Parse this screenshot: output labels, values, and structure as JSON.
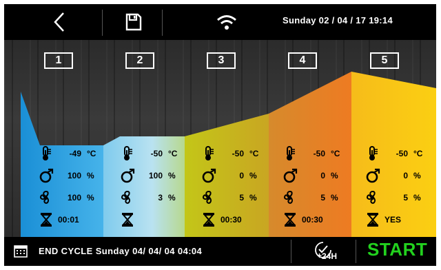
{
  "header": {
    "back_icon": "back-arrow-icon",
    "save_icon": "floppy-disk-icon",
    "wifi_icon": "wifi-icon",
    "datetime": "Sunday 02 / 04 / 17  19:14"
  },
  "phases": [
    {
      "number": "1",
      "temperature": "-49",
      "temp_unit": "°C",
      "vacuum": "100",
      "vacuum_unit": "%",
      "fan": "100",
      "fan_unit": "%",
      "time": "00:01"
    },
    {
      "number": "2",
      "temperature": "-50",
      "temp_unit": "°C",
      "vacuum": "100",
      "vacuum_unit": "%",
      "fan": "3",
      "fan_unit": "%",
      "time": ""
    },
    {
      "number": "3",
      "temperature": "-50",
      "temp_unit": "°C",
      "vacuum": "0",
      "vacuum_unit": "%",
      "fan": "5",
      "fan_unit": "%",
      "time": "00:30"
    },
    {
      "number": "4",
      "temperature": "-50",
      "temp_unit": "°C",
      "vacuum": "0",
      "vacuum_unit": "%",
      "fan": "5",
      "fan_unit": "%",
      "time": "00:30"
    },
    {
      "number": "5",
      "temperature": "-50",
      "temp_unit": "°C",
      "vacuum": "0",
      "vacuum_unit": "%",
      "fan": "5",
      "fan_unit": "%",
      "time": "YES"
    }
  ],
  "footer": {
    "calendar_icon": "calendar-icon",
    "end_cycle": "END  CYCLE  Sunday  04/ 04/ 04  04:04",
    "timer_label": "24H",
    "start_label": "START"
  },
  "colors": {
    "phase1": "#1a90d6",
    "phase2": "#8fd0ea",
    "phase3": "#b8c21e",
    "phase4": "#e07a2a",
    "phase5": "#f4c21a",
    "start": "#22d11e"
  }
}
